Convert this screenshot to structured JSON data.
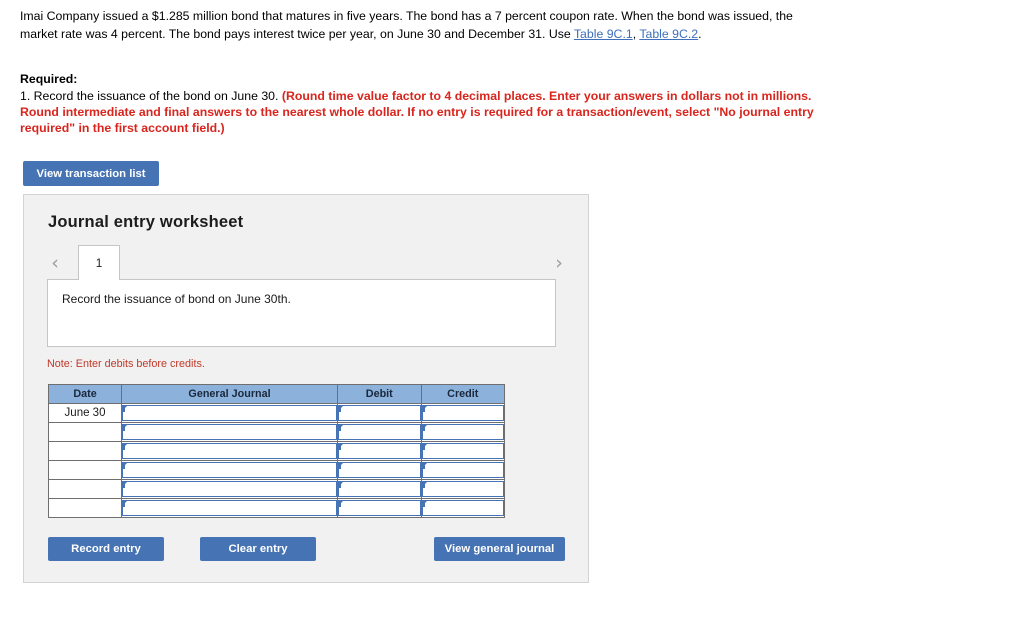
{
  "problem": {
    "text_part_1": "Imai Company issued a $1.285 million bond that matures in five years. The bond has a 7 percent coupon rate. When the bond was issued, the market rate was 4 percent. The bond pays interest twice per year, on June 30 and December 31. Use ",
    "link_1": "Table 9C.1",
    "separator": ", ",
    "link_2": "Table 9C.2",
    "text_part_2": "."
  },
  "required": {
    "label": "Required:",
    "item_number": "1. Record the issuance of the bond on June 30. ",
    "instruction_red": "(Round time value factor to 4 decimal places. Enter your answers in dollars not in millions. Round intermediate and final answers to the nearest whole dollar. If no entry is required for a transaction/event, select \"No journal entry required\" in the first account field.)"
  },
  "toolbar": {
    "view_transaction_list_label": "View transaction list"
  },
  "worksheet": {
    "title": "Journal entry worksheet",
    "prev_icon": "chevron-left-icon",
    "next_icon": "chevron-right-icon",
    "tabs": [
      {
        "label": "1",
        "selected": true
      }
    ],
    "description": "Record the issuance of bond on June 30th.",
    "note": "Note: Enter debits before credits."
  },
  "journal_table": {
    "headers": [
      "Date",
      "General Journal",
      "Debit",
      "Credit"
    ],
    "rows": [
      {
        "date": "June 30",
        "general_journal": "",
        "debit": "",
        "credit": ""
      },
      {
        "date": "",
        "general_journal": "",
        "debit": "",
        "credit": ""
      },
      {
        "date": "",
        "general_journal": "",
        "debit": "",
        "credit": ""
      },
      {
        "date": "",
        "general_journal": "",
        "debit": "",
        "credit": ""
      },
      {
        "date": "",
        "general_journal": "",
        "debit": "",
        "credit": ""
      },
      {
        "date": "",
        "general_journal": "",
        "debit": "",
        "credit": ""
      }
    ]
  },
  "actions": {
    "record_entry_label": "Record entry",
    "clear_entry_label": "Clear entry",
    "view_general_journal_label": "View general journal"
  },
  "colors": {
    "button_blue": "#4573b4",
    "table_header_blue": "#8cb2dc",
    "link_blue": "#3f6fba",
    "alert_red": "#d9251d",
    "note_red": "#c0392b",
    "panel_gray": "#f1f1f1"
  }
}
